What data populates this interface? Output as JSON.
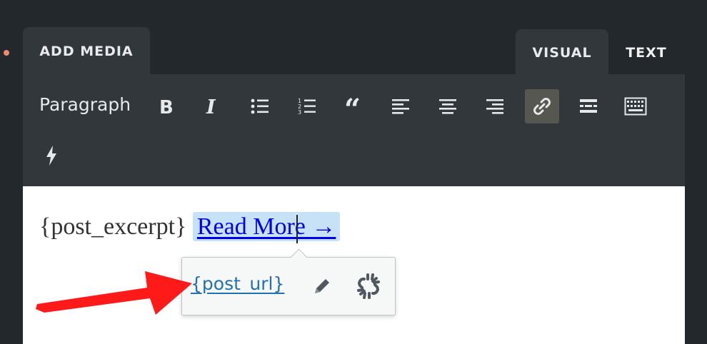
{
  "tabs": {
    "add_media": "ADD MEDIA",
    "visual": "VISUAL",
    "text": "TEXT"
  },
  "toolbar": {
    "format_select": "Paragraph",
    "buttons": [
      "bold-icon",
      "italic-icon",
      "bulleted-list-icon",
      "numbered-list-icon",
      "blockquote-icon",
      "align-left-icon",
      "align-center-icon",
      "align-right-icon",
      "link-icon",
      "read-more-icon",
      "toolbar-toggle-icon",
      "shortcode-icon"
    ],
    "active_button": "link-icon"
  },
  "editor": {
    "excerpt": "{post_excerpt}",
    "link_text": "Read More →"
  },
  "link_popup": {
    "url": "{post_url}",
    "buttons": [
      "edit-pencil-icon",
      "unlink-icon"
    ]
  },
  "colors": {
    "background": "#23282d",
    "toolbar": "#32373c",
    "selection": "#c7e1f7",
    "link": "#2271b1",
    "annotation_arrow": "#ff1a1a"
  }
}
